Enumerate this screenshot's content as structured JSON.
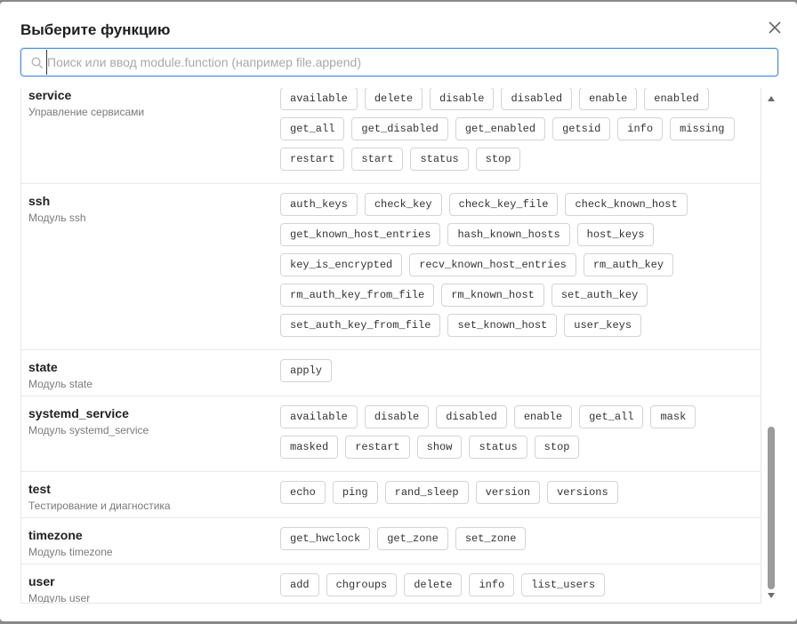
{
  "dialog": {
    "title": "Выберите функцию",
    "close_icon": "close-icon"
  },
  "search": {
    "placeholder": "Поиск или ввод module.function (например file.append)",
    "value": "",
    "icon": "search-icon"
  },
  "modules": [
    {
      "name": "service",
      "description": "Управление сервисами",
      "functions": [
        "available",
        "delete",
        "disable",
        "disabled",
        "enable",
        "enabled",
        "get_all",
        "get_disabled",
        "get_enabled",
        "getsid",
        "info",
        "missing",
        "restart",
        "start",
        "status",
        "stop"
      ]
    },
    {
      "name": "ssh",
      "description": "Модуль ssh",
      "functions": [
        "auth_keys",
        "check_key",
        "check_key_file",
        "check_known_host",
        "get_known_host_entries",
        "hash_known_hosts",
        "host_keys",
        "key_is_encrypted",
        "recv_known_host_entries",
        "rm_auth_key",
        "rm_auth_key_from_file",
        "rm_known_host",
        "set_auth_key",
        "set_auth_key_from_file",
        "set_known_host",
        "user_keys"
      ]
    },
    {
      "name": "state",
      "description": "Модуль state",
      "functions": [
        "apply"
      ]
    },
    {
      "name": "systemd_service",
      "description": "Модуль systemd_service",
      "functions": [
        "available",
        "disable",
        "disabled",
        "enable",
        "get_all",
        "mask",
        "masked",
        "restart",
        "show",
        "status",
        "stop"
      ]
    },
    {
      "name": "test",
      "description": "Тестирование и диагностика",
      "functions": [
        "echo",
        "ping",
        "rand_sleep",
        "version",
        "versions"
      ]
    },
    {
      "name": "timezone",
      "description": "Модуль timezone",
      "functions": [
        "get_hwclock",
        "get_zone",
        "set_zone"
      ]
    },
    {
      "name": "user",
      "description": "Модуль user",
      "functions": [
        "add",
        "chgroups",
        "delete",
        "info",
        "list_users"
      ]
    }
  ],
  "scrollbar": {
    "position_fraction": 0.65
  }
}
